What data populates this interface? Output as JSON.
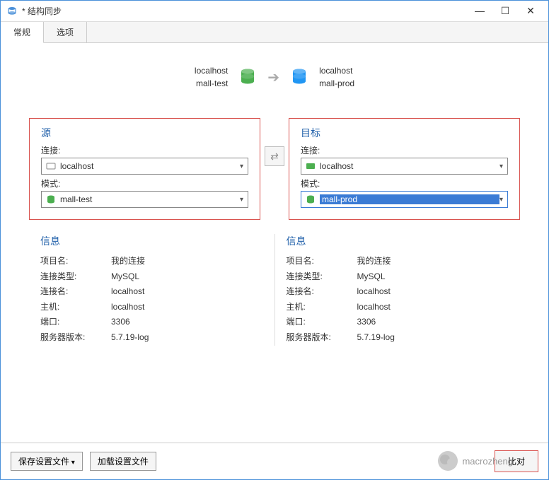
{
  "window": {
    "title": "* 结构同步"
  },
  "tabs": {
    "general": "常规",
    "options": "选项"
  },
  "summary": {
    "source_host": "localhost",
    "source_schema": "mall-test",
    "target_host": "localhost",
    "target_schema": "mall-prod"
  },
  "source": {
    "title": "源",
    "connection_label": "连接:",
    "connection_value": "localhost",
    "schema_label": "模式:",
    "schema_value": "mall-test"
  },
  "target": {
    "title": "目标",
    "connection_label": "连接:",
    "connection_value": "localhost",
    "schema_label": "模式:",
    "schema_value": "mall-prod"
  },
  "info": {
    "title": "信息",
    "labels": {
      "project": "项目名:",
      "conn_type": "连接类型:",
      "conn_name": "连接名:",
      "host": "主机:",
      "port": "端口:",
      "version": "服务器版本:"
    },
    "source": {
      "project": "我的连接",
      "conn_type": "MySQL",
      "conn_name": "localhost",
      "host": "localhost",
      "port": "3306",
      "version": "5.7.19-log"
    },
    "target": {
      "project": "我的连接",
      "conn_type": "MySQL",
      "conn_name": "localhost",
      "host": "localhost",
      "port": "3306",
      "version": "5.7.19-log"
    }
  },
  "footer": {
    "save_profile": "保存设置文件",
    "load_profile": "加载设置文件",
    "compare": "比对"
  },
  "watermark": "macrozheng"
}
